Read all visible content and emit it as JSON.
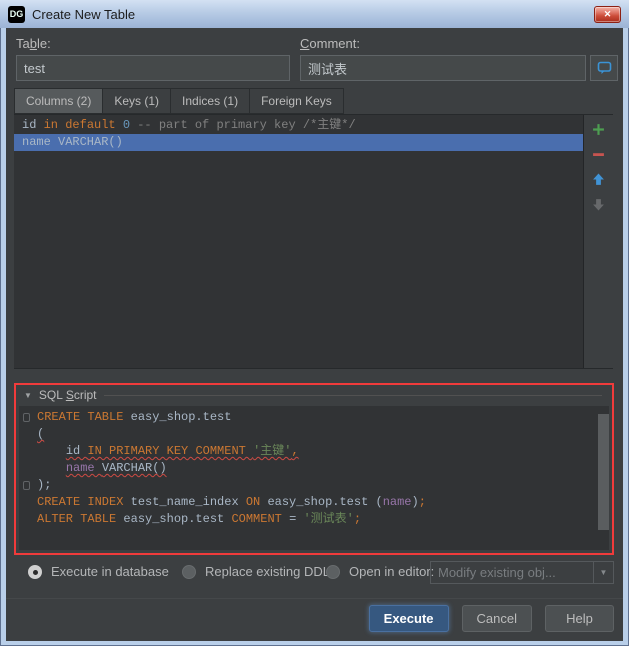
{
  "title_bar": {
    "title": "Create New Table",
    "app_icon_text": "DG"
  },
  "icons": {
    "close_glyph": "✕",
    "collapse_glyph": "▼",
    "combo_arrow_glyph": "▼"
  },
  "form": {
    "table_label": {
      "pre": "Ta",
      "mn": "b",
      "post": "le:"
    },
    "table_value": "test",
    "comment_label": {
      "pre": "",
      "mn": "C",
      "post": "omment:"
    },
    "comment_value": "测试表"
  },
  "tabs": [
    {
      "label": "Columns (2)",
      "selected": true
    },
    {
      "label": "Keys (1)",
      "selected": false
    },
    {
      "label": "Indices (1)",
      "selected": false
    },
    {
      "label": "Foreign Keys",
      "selected": false
    }
  ],
  "columns_list": {
    "rows": [
      {
        "selected": false,
        "tokens": [
          {
            "t": "id ",
            "c": "plain"
          },
          {
            "t": "in ",
            "c": "keyword"
          },
          {
            "t": "default ",
            "c": "keyword"
          },
          {
            "t": "0 ",
            "c": "number"
          },
          {
            "t": "-- part of primary key /*主键*/",
            "c": "comment"
          }
        ]
      },
      {
        "selected": true,
        "tokens": [
          {
            "t": "name VARCHAR()",
            "c": "plain"
          }
        ]
      }
    ],
    "toolbar": [
      {
        "name": "add",
        "color": "#4d9e51"
      },
      {
        "name": "remove",
        "color": "#c75450"
      },
      {
        "name": "move-up",
        "color": "#4093d5"
      },
      {
        "name": "move-down",
        "color": "#67696b"
      }
    ]
  },
  "sql_script": {
    "header": {
      "pre": "SQL ",
      "mn": "S",
      "post": "cript"
    },
    "lines": [
      {
        "tokens": [
          {
            "t": "CREATE TABLE ",
            "c": "keyword"
          },
          {
            "t": "easy_shop.test",
            "c": "plain"
          }
        ]
      },
      {
        "tokens": [
          {
            "t": "(",
            "c": "plain",
            "err": true
          }
        ]
      },
      {
        "tokens": [
          {
            "t": "    ",
            "c": "plain"
          },
          {
            "t": "id ",
            "c": "plain",
            "err": true
          },
          {
            "t": "IN PRIMARY KEY COMMENT ",
            "c": "keyword",
            "err": true
          },
          {
            "t": "'主键'",
            "c": "string",
            "err": true
          },
          {
            "t": ",",
            "c": "keyword",
            "err": true
          }
        ]
      },
      {
        "tokens": [
          {
            "t": "    ",
            "c": "plain"
          },
          {
            "t": "name ",
            "c": "column",
            "err": true
          },
          {
            "t": "VARCHAR()",
            "c": "plain",
            "err": true
          }
        ]
      },
      {
        "tokens": [
          {
            "t": ");",
            "c": "plain"
          }
        ]
      },
      {
        "tokens": [
          {
            "t": "CREATE INDEX ",
            "c": "keyword"
          },
          {
            "t": "test_name_index ",
            "c": "plain"
          },
          {
            "t": "ON ",
            "c": "keyword"
          },
          {
            "t": "easy_shop.test ",
            "c": "plain"
          },
          {
            "t": "(",
            "c": "plain"
          },
          {
            "t": "name",
            "c": "column"
          },
          {
            "t": ")",
            "c": "plain"
          },
          {
            "t": ";",
            "c": "keyword"
          }
        ]
      },
      {
        "tokens": [
          {
            "t": "ALTER TABLE ",
            "c": "keyword"
          },
          {
            "t": "easy_shop.test ",
            "c": "plain"
          },
          {
            "t": "COMMENT ",
            "c": "keyword"
          },
          {
            "t": "= ",
            "c": "plain"
          },
          {
            "t": "'测试表'",
            "c": "string"
          },
          {
            "t": ";",
            "c": "keyword"
          }
        ]
      }
    ]
  },
  "options": {
    "radios": [
      {
        "label": "Execute in database",
        "selected": true
      },
      {
        "label": "Replace existing DDL",
        "selected": false
      },
      {
        "label": "Open in editor:",
        "selected": false
      }
    ],
    "combo": {
      "value": "Modify existing obj...",
      "disabled": true
    }
  },
  "buttons": [
    {
      "label": "Execute",
      "primary": true
    },
    {
      "label": "Cancel",
      "primary": false
    },
    {
      "label": "Help",
      "primary": false
    }
  ],
  "colors": {
    "keyword": "#cc7832",
    "number": "#6897bb",
    "comment": "#808080",
    "string": "#6a8759",
    "plain": "#a9b7c6",
    "column": "#9876aa",
    "selection": "#4a6eae",
    "annotation": "#f13b3b"
  }
}
